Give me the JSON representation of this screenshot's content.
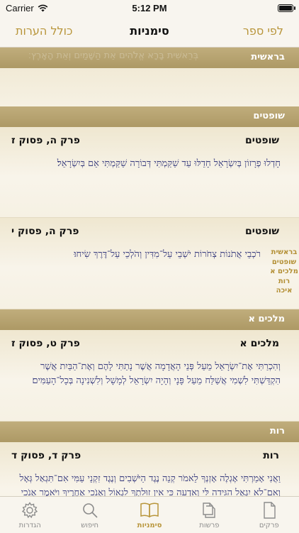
{
  "status_bar": {
    "carrier": "Carrier",
    "time": "5:12 PM"
  },
  "nav": {
    "left_label": "כולל הערות",
    "title": "סימניות",
    "right_label": "לפי ספר"
  },
  "sections": [
    {
      "header": "בראשית",
      "ghost_text": "בְּרֵאשִׁית בָּרָא אֱלֹהִים אֵת הַשָּׁמַיִם וְאֵת הָאָרֶץ׃",
      "items": []
    },
    {
      "header": "שופטים",
      "items": [
        {
          "book": "שופטים",
          "ref": "פרק ה, פסוק ז",
          "verse": "חָדְלוּ פְרָזוֹן בְּיִשְׂרָאֵל חָדֵלּוּ עַד שַׁקַּמְתִּי דְּבוֹרָה שַׁקַּמְתִּי אֵם בְּיִשְׂרָאֵל׃"
        },
        {
          "book": "שופטים",
          "ref": "פרק ה, פסוק י",
          "verse": "רֹכְבֵי אֲתֹנוֹת צְחֹרוֹת יֹשְׁבֵי עַל־מִדִּין וְהֹלְכֵי עַל־דֶּרֶךְ שִׂיחוּ׃"
        }
      ]
    },
    {
      "header": "מלכים א",
      "items": [
        {
          "book": "מלכים א",
          "ref": "פרק ט, פסוק ז",
          "verse": "וְהִכְרַתִּי אֶת־יִשְׂרָאֵל מֵעַל פְּנֵי הָאֲדָמָה אֲשֶׁר נָתַתִּי לָהֶם וְאֶת־הַבַּיִת אֲשֶׁר הִקְדַּשְׁתִּי לִשְׁמִי אֲשַׁלַּח מֵעַל פָּנָי וְהָיָה יִשְׂרָאֵל לְמָשָׁל וְלִשְׁנִינָה בְּכָל־הָעַמִּים׃"
        }
      ]
    },
    {
      "header": "רות",
      "items": [
        {
          "book": "רות",
          "ref": "פרק ד, פסוק ד",
          "verse": "וַאֲנִי אָמַרְתִּי אֶגְלֶה אָזְנְךָ לֵאמֹר קְנֵה נֶגֶד הַיֹּשְׁבִים וְנֶגֶד זִקְנֵי עַמִּי אִם־תִּגְאַל גְּאָל וְאִם־לֹא יִגְאַל הַגִּידָה לִּי וְאֵדְעָה כִּי אֵין זוּלָתְךָ לִגְאוֹל וְאָנֹכִי אַחֲרֶיךָ וַיֹּאמֶר אָנֹכִי אֶגְאָל׃"
        }
      ]
    }
  ],
  "index": [
    "בראשית",
    "שופטים",
    "מלכים א",
    "רות",
    "איכה"
  ],
  "tabs": [
    {
      "label": "הגדרות",
      "icon": "gear-icon"
    },
    {
      "label": "חיפוש",
      "icon": "search-icon"
    },
    {
      "label": "סימניות",
      "icon": "book-icon",
      "active": true
    },
    {
      "label": "פרשות",
      "icon": "documents-icon"
    },
    {
      "label": "פרקים",
      "icon": "document-icon"
    }
  ],
  "colors": {
    "accent": "#b8953a",
    "section_header": "#b5a170",
    "verse_text": "#3d4180"
  }
}
